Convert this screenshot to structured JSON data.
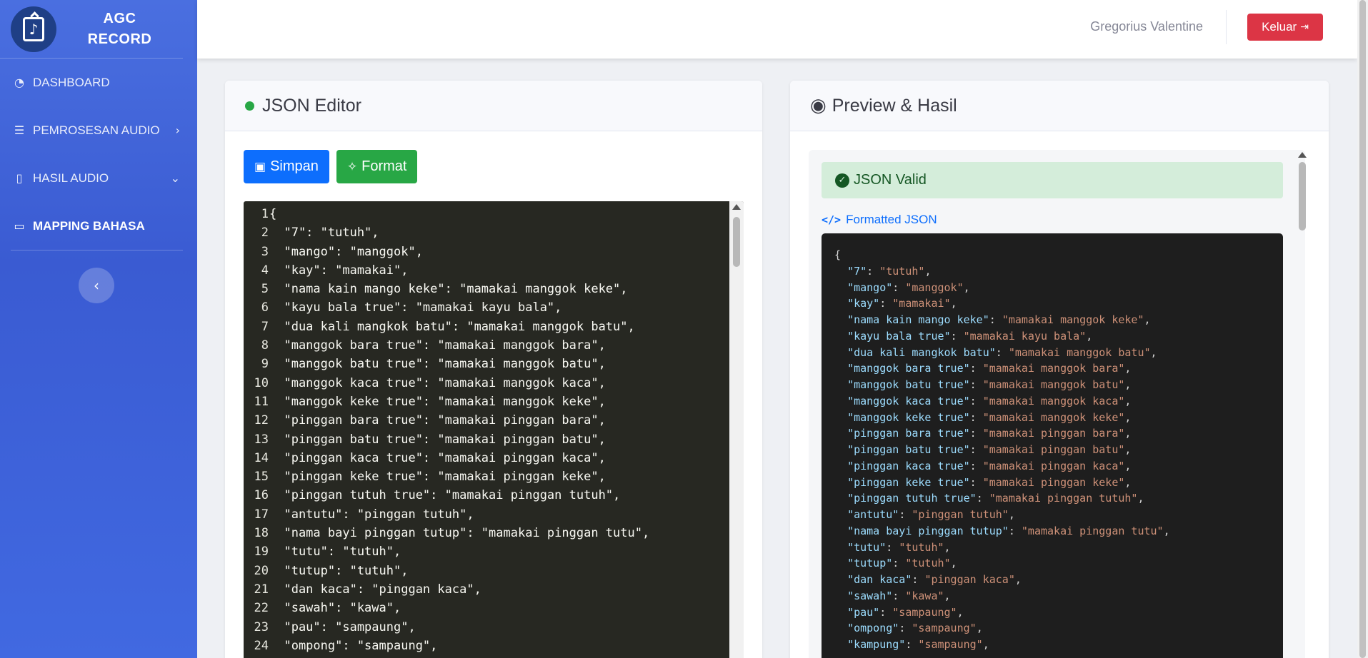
{
  "brand": {
    "line1": "AGC",
    "line2": "RECORD",
    "logo_icon": "music-file-icon"
  },
  "sidebar": {
    "items": [
      {
        "label": "DASHBOARD",
        "icon": "tachometer-icon"
      },
      {
        "label": "PEMROSESAN AUDIO",
        "icon": "music-list-icon",
        "chevron": "›"
      },
      {
        "label": "HASIL AUDIO",
        "icon": "audio-file-icon",
        "chevron": "⌄"
      },
      {
        "label": "MAPPING BAHASA",
        "icon": "folder-icon",
        "active": true
      }
    ],
    "toggle_icon": "‹"
  },
  "topbar": {
    "username": "Gregorius Valentine",
    "logout_label": "Keluar"
  },
  "editor_card": {
    "title": "JSON Editor",
    "save_label": "Simpan",
    "format_label": "Format",
    "lines": [
      "{",
      "  \"7\": \"tutuh\",",
      "  \"mango\": \"manggok\",",
      "  \"kay\": \"mamakai\",",
      "  \"nama kain mango keke\": \"mamakai manggok keke\",",
      "  \"kayu bala true\": \"mamakai kayu bala\",",
      "  \"dua kali mangkok batu\": \"mamakai manggok batu\",",
      "  \"manggok bara true\": \"mamakai manggok bara\",",
      "  \"manggok batu true\": \"mamakai manggok batu\",",
      "  \"manggok kaca true\": \"mamakai manggok kaca\",",
      "  \"manggok keke true\": \"mamakai manggok keke\",",
      "  \"pinggan bara true\": \"mamakai pinggan bara\",",
      "  \"pinggan batu true\": \"mamakai pinggan batu\",",
      "  \"pinggan kaca true\": \"mamakai pinggan kaca\",",
      "  \"pinggan keke true\": \"mamakai pinggan keke\",",
      "  \"pinggan tutuh true\": \"mamakai pinggan tutuh\",",
      "  \"antutu\": \"pinggan tutuh\",",
      "  \"nama bayi pinggan tutup\": \"mamakai pinggan tutu\",",
      "  \"tutu\": \"tutuh\",",
      "  \"tutup\": \"tutuh\",",
      "  \"dan kaca\": \"pinggan kaca\",",
      "  \"sawah\": \"kawa\",",
      "  \"pau\": \"sampaung\",",
      "  \"ompong\": \"sampaung\","
    ]
  },
  "preview_card": {
    "title": "Preview & Hasil",
    "valid_label": "JSON Valid",
    "formatted_label": "Formatted JSON",
    "pairs": [
      [
        "7",
        "tutuh"
      ],
      [
        "mango",
        "manggok"
      ],
      [
        "kay",
        "mamakai"
      ],
      [
        "nama kain mango keke",
        "mamakai manggok keke"
      ],
      [
        "kayu bala true",
        "mamakai kayu bala"
      ],
      [
        "dua kali mangkok batu",
        "mamakai manggok batu"
      ],
      [
        "manggok bara true",
        "mamakai manggok bara"
      ],
      [
        "manggok batu true",
        "mamakai manggok batu"
      ],
      [
        "manggok kaca true",
        "mamakai manggok kaca"
      ],
      [
        "manggok keke true",
        "mamakai manggok keke"
      ],
      [
        "pinggan bara true",
        "mamakai pinggan bara"
      ],
      [
        "pinggan batu true",
        "mamakai pinggan batu"
      ],
      [
        "pinggan kaca true",
        "mamakai pinggan kaca"
      ],
      [
        "pinggan keke true",
        "mamakai pinggan keke"
      ],
      [
        "pinggan tutuh true",
        "mamakai pinggan tutuh"
      ],
      [
        "antutu",
        "pinggan tutuh"
      ],
      [
        "nama bayi pinggan tutup",
        "mamakai pinggan tutu"
      ],
      [
        "tutu",
        "tutuh"
      ],
      [
        "tutup",
        "tutuh"
      ],
      [
        "dan kaca",
        "pinggan kaca"
      ],
      [
        "sawah",
        "kawa"
      ],
      [
        "pau",
        "sampaung"
      ],
      [
        "ompong",
        "sampaung"
      ],
      [
        "kampung",
        "sampaung"
      ]
    ]
  },
  "colors": {
    "sidebar": "#4169e1",
    "logout": "#dc3545",
    "save": "#0d6efd",
    "format": "#28a745",
    "editor_bg": "#272822",
    "valid_bg": "#d4edda"
  }
}
